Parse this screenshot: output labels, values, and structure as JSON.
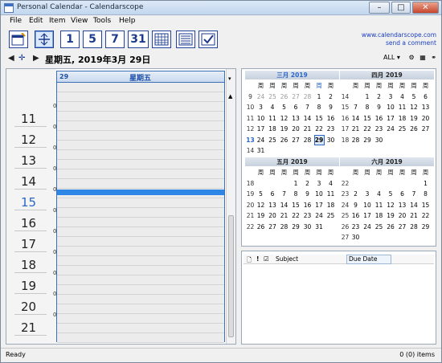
{
  "window": {
    "title": "Personal Calendar - Calendarscope",
    "minimize_glyph": "–",
    "maximize_glyph": "□",
    "close_glyph": "✕"
  },
  "menu": [
    "File",
    "Edit",
    "Item",
    "View",
    "Tools",
    "Help"
  ],
  "toolbar": {
    "buttons": [
      {
        "icon": "new-event-icon"
      },
      {
        "icon": "jump-to-date-icon"
      },
      {
        "icon": "day-view-icon",
        "label": "1"
      },
      {
        "icon": "workweek-view-icon",
        "label": "5"
      },
      {
        "icon": "week-view-icon",
        "label": "7"
      },
      {
        "icon": "month-view-icon",
        "label": "31"
      },
      {
        "icon": "year-view-icon"
      },
      {
        "icon": "list-view-icon"
      },
      {
        "icon": "tasks-view-icon"
      }
    ],
    "link_site": "www.calendarscope.com",
    "link_comment": "send a comment"
  },
  "nav": {
    "date_text": "星期五, 2019年3月 29日",
    "filter_label": "ALL"
  },
  "day_view": {
    "header_num": "29",
    "header_day": "星期五",
    "hours": [
      "11",
      "12",
      "13",
      "14",
      "15",
      "16",
      "17",
      "18",
      "19",
      "20",
      "21"
    ],
    "current_hour": "15",
    "minute_label": "00"
  },
  "mini_calendar": {
    "weekday_headers": [
      "周",
      "周",
      "周",
      "周",
      "周",
      "周",
      "周"
    ],
    "months": [
      {
        "name": "三月 2019",
        "current": true,
        "weeks": [
          {
            "wn": "9",
            "days": [
              "24",
              "25",
              "26",
              "27",
              "28",
              "1",
              "2"
            ]
          },
          {
            "wn": "10",
            "days": [
              "3",
              "4",
              "5",
              "6",
              "7",
              "8",
              "9"
            ]
          },
          {
            "wn": "11",
            "days": [
              "10",
              "11",
              "12",
              "13",
              "14",
              "15",
              "16"
            ]
          },
          {
            "wn": "12",
            "days": [
              "17",
              "18",
              "19",
              "20",
              "21",
              "22",
              "23"
            ]
          },
          {
            "wn": "13",
            "days": [
              "24",
              "25",
              "26",
              "27",
              "28",
              "29",
              "30"
            ]
          },
          {
            "wn": "14",
            "days": [
              "31",
              "",
              "",
              "",
              "",
              "",
              ""
            ]
          }
        ]
      },
      {
        "name": "四月 2019",
        "current": false,
        "weeks": [
          {
            "wn": "14",
            "days": [
              "",
              "1",
              "2",
              "3",
              "4",
              "5",
              "6"
            ]
          },
          {
            "wn": "15",
            "days": [
              "7",
              "8",
              "9",
              "10",
              "11",
              "12",
              "13"
            ]
          },
          {
            "wn": "16",
            "days": [
              "14",
              "15",
              "16",
              "17",
              "18",
              "19",
              "20"
            ]
          },
          {
            "wn": "17",
            "days": [
              "21",
              "22",
              "23",
              "24",
              "25",
              "26",
              "27"
            ]
          },
          {
            "wn": "18",
            "days": [
              "28",
              "29",
              "30",
              "",
              "",
              "",
              ""
            ]
          }
        ]
      },
      {
        "name": "五月 2019",
        "current": false,
        "weeks": [
          {
            "wn": "18",
            "days": [
              "",
              "",
              "",
              "1",
              "2",
              "3",
              "4"
            ]
          },
          {
            "wn": "19",
            "days": [
              "5",
              "6",
              "7",
              "8",
              "9",
              "10",
              "11"
            ]
          },
          {
            "wn": "20",
            "days": [
              "12",
              "13",
              "14",
              "15",
              "16",
              "17",
              "18"
            ]
          },
          {
            "wn": "21",
            "days": [
              "19",
              "20",
              "21",
              "22",
              "23",
              "24",
              "25"
            ]
          },
          {
            "wn": "22",
            "days": [
              "26",
              "27",
              "28",
              "29",
              "30",
              "31",
              ""
            ]
          }
        ]
      },
      {
        "name": "六月 2019",
        "current": false,
        "weeks": [
          {
            "wn": "22",
            "days": [
              "",
              "",
              "",
              "",
              "",
              "",
              "1"
            ]
          },
          {
            "wn": "23",
            "days": [
              "2",
              "3",
              "4",
              "5",
              "6",
              "7",
              "8"
            ]
          },
          {
            "wn": "24",
            "days": [
              "9",
              "10",
              "11",
              "12",
              "13",
              "14",
              "15"
            ]
          },
          {
            "wn": "25",
            "days": [
              "16",
              "17",
              "18",
              "19",
              "20",
              "21",
              "22"
            ]
          },
          {
            "wn": "26",
            "days": [
              "23",
              "24",
              "25",
              "26",
              "27",
              "28",
              "29"
            ]
          },
          {
            "wn": "27",
            "days": [
              "30",
              "",
              "",
              "",
              "",
              "",
              ""
            ]
          }
        ]
      }
    ],
    "today": "29"
  },
  "tasks": {
    "col_subject": "Subject",
    "col_due": "Due Date"
  },
  "status": {
    "left": "Ready",
    "right": "0 (0) items"
  },
  "colors": {
    "accent": "#2a66c8",
    "now_bar": "#2e86e6",
    "toolbar_border": "#23429a"
  }
}
